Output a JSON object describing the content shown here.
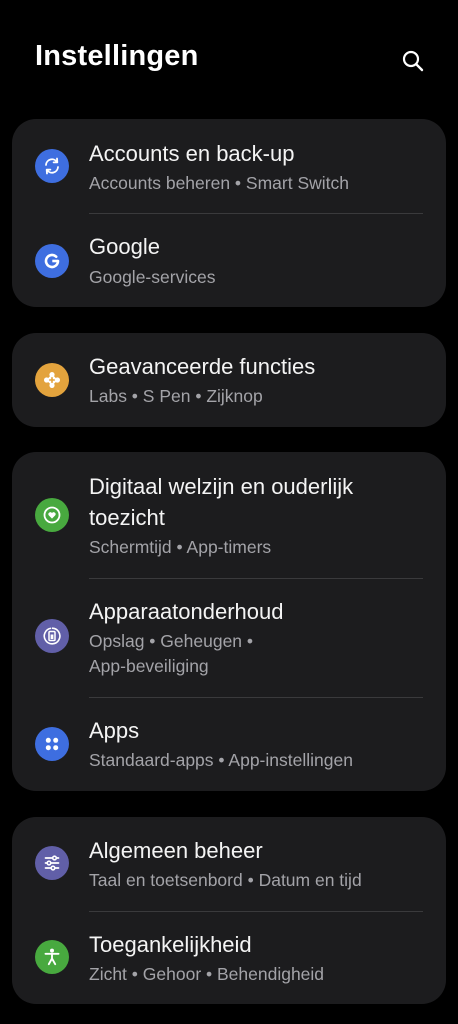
{
  "header": {
    "title": "Instellingen",
    "search_icon": "search-icon"
  },
  "colors": {
    "background": "#000000",
    "card": "#1c1c1e",
    "accounts_icon": "#3e6ee0",
    "google_icon": "#3e6ee0",
    "advanced_icon": "#e3a33d",
    "wellbeing_icon": "#48a93f",
    "device_care_icon": "#615fa8",
    "apps_icon": "#3e6ee0",
    "general_icon": "#615fa8",
    "accessibility_icon": "#48a93f"
  },
  "groups": [
    {
      "items": [
        {
          "label": "Accounts en back-up",
          "sub": "Accounts beheren  •  Smart Switch",
          "icon": "sync-icon"
        },
        {
          "label": "Google",
          "sub": "Google-services",
          "icon": "google-icon"
        }
      ]
    },
    {
      "items": [
        {
          "label": "Geavanceerde functies",
          "sub": "Labs  •  S Pen  •  Zijknop",
          "icon": "gear-plus-icon"
        }
      ]
    },
    {
      "items": [
        {
          "label_line1": "Digitaal welzijn en ouderlijk",
          "label_line2": "toezicht",
          "sub": "Schermtijd  •  App-timers",
          "icon": "heart-circle-icon"
        },
        {
          "label": "Apparaatonderhoud",
          "sub_line1": "Opslag  •  Geheugen  •",
          "sub_line2": "App-beveiliging",
          "icon": "device-care-icon"
        },
        {
          "label": "Apps",
          "sub": "Standaard-apps  •  App-instellingen",
          "icon": "apps-grid-icon"
        }
      ]
    },
    {
      "items": [
        {
          "label": "Algemeen beheer",
          "sub": "Taal en toetsenbord  •  Datum en tijd",
          "icon": "sliders-icon"
        },
        {
          "label": "Toegankelijkheid",
          "sub": "Zicht  •  Gehoor  •  Behendigheid",
          "icon": "accessibility-icon"
        }
      ]
    }
  ]
}
